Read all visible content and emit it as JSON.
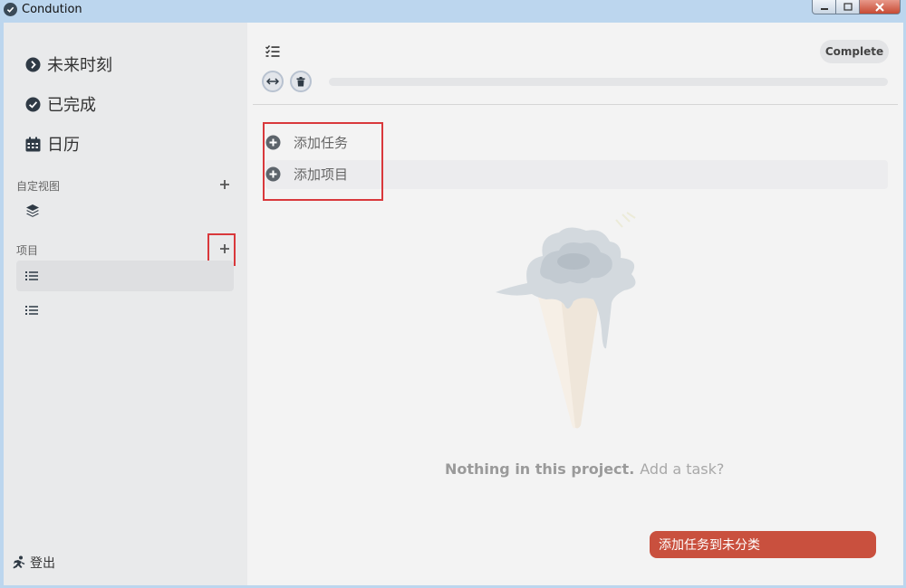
{
  "window": {
    "title": "Condution"
  },
  "sidebar": {
    "nav": [
      {
        "label": "未来时刻",
        "icon": "chevron-right-circle-icon"
      },
      {
        "label": "已完成",
        "icon": "check-circle-icon"
      },
      {
        "label": "日历",
        "icon": "calendar-icon"
      }
    ],
    "custom_views": {
      "title": "自定视图",
      "add_icon": "plus-icon",
      "items": [
        {
          "icon": "layers-icon"
        }
      ]
    },
    "projects": {
      "title": "项目",
      "add_icon": "plus-icon",
      "items": [
        {
          "icon": "list-icon",
          "active": true
        },
        {
          "icon": "list-icon",
          "active": false
        }
      ]
    },
    "logout": {
      "label": "登出",
      "icon": "logout-icon"
    }
  },
  "main": {
    "header_icon": "tasklist-icon",
    "complete_label": "Complete",
    "add_task_label": "添加任务",
    "add_project_label": "添加项目",
    "empty_message": "Nothing in this project.",
    "empty_link": "Add a task?",
    "add_unsorted_button": "添加任务到未分类",
    "illustration": "melted-ice-cream-cone"
  },
  "colors": {
    "accent": "#c9503e",
    "sidebar_bg": "#e9eaeb",
    "main_bg": "#f3f3f3",
    "highlight_box": "#d9383b"
  }
}
